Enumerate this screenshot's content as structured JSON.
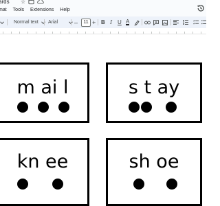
{
  "document": {
    "title": "ards"
  },
  "menu": {
    "items": [
      "mat",
      "Tools",
      "Extensions",
      "Help"
    ]
  },
  "toolbar": {
    "style_label": "Normal text",
    "font_label": "Arial",
    "font_size": "11"
  },
  "cards": [
    {
      "word": "m ai l",
      "sounds": 3
    },
    {
      "word": "s t ay",
      "sounds": 3
    },
    {
      "word": "kn ee",
      "sounds": 2
    },
    {
      "word": "sh oe",
      "sounds": 2
    }
  ]
}
